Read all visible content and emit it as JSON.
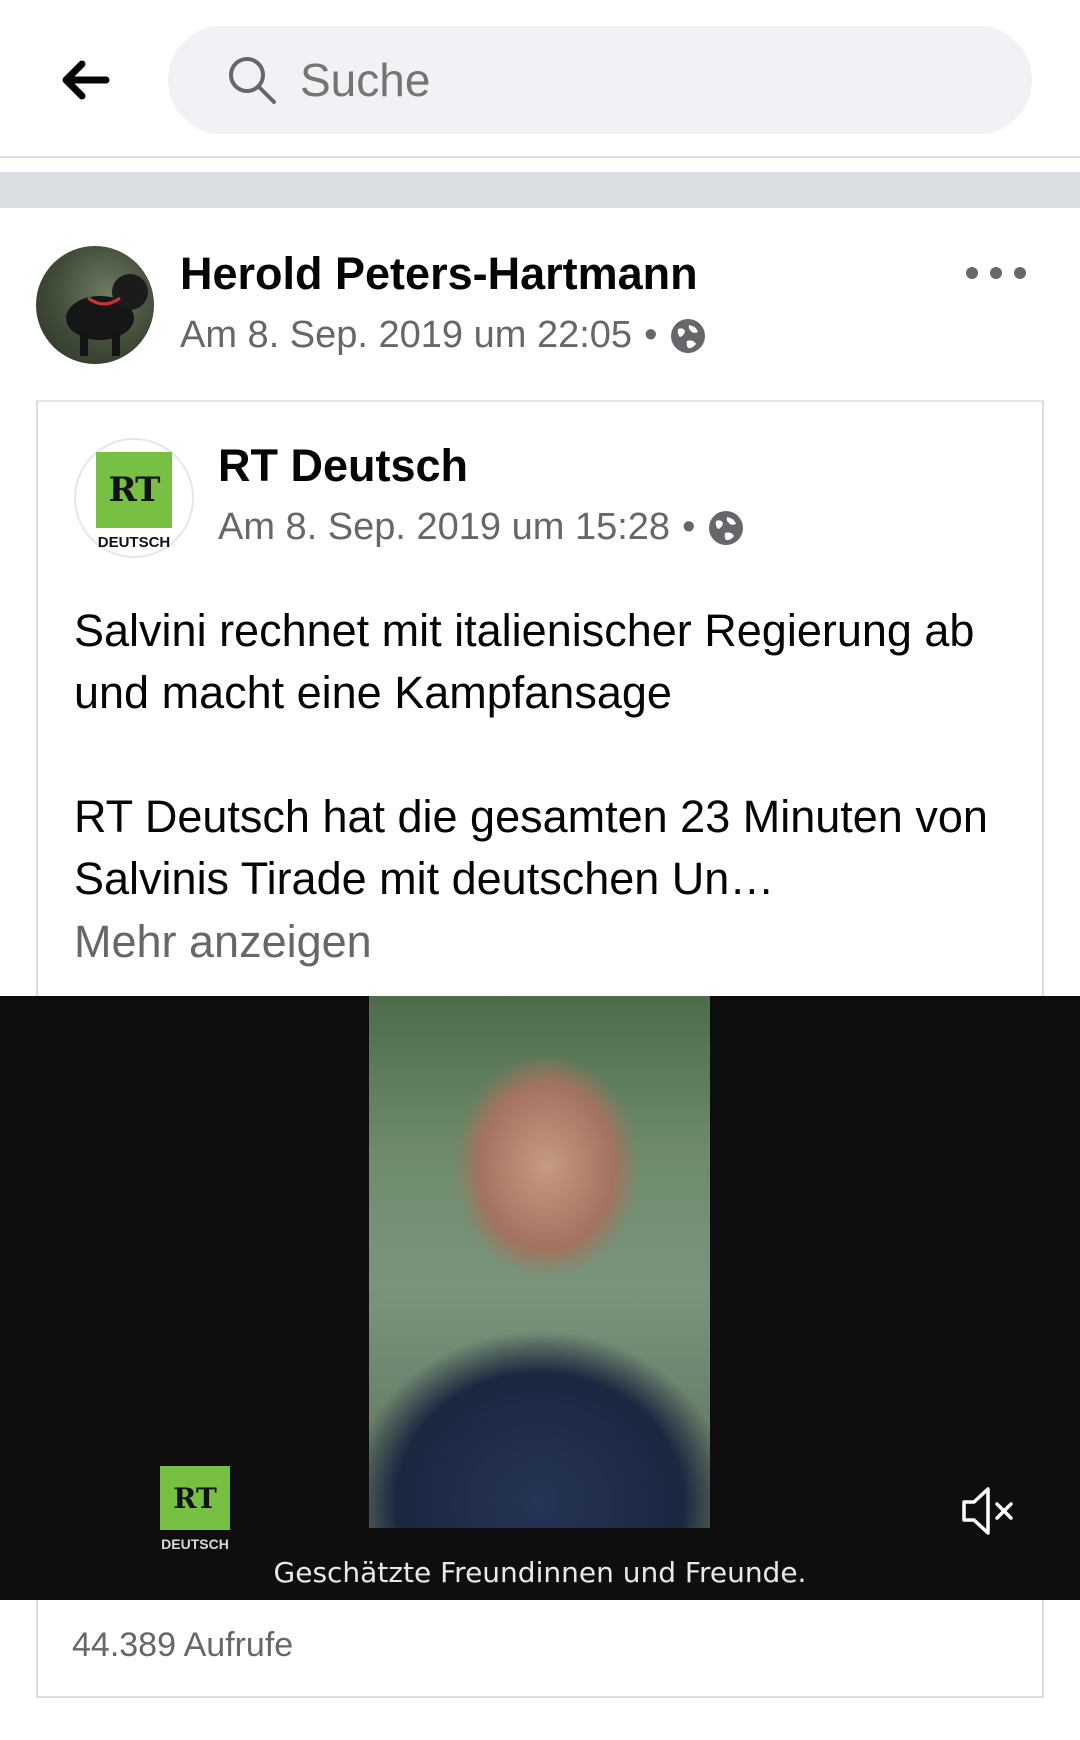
{
  "search": {
    "placeholder": "Suche"
  },
  "post": {
    "author": "Herold Peters-Hartmann",
    "timestamp": "Am 8. Sep. 2019 um 22:05",
    "separator": "•",
    "privacy_icon": "globe-icon",
    "more_icon": "more-options-icon"
  },
  "shared": {
    "page_logo_text": "RT",
    "page_logo_sub": "DEUTSCH",
    "page_name": "RT Deutsch",
    "timestamp": "Am 8. Sep. 2019 um 15:28",
    "separator": "•",
    "text_line1": "Salvini rechnet mit italienischer Regierung ab und macht eine Kampfansage",
    "text_line2": "RT Deutsch hat die gesamten 23 Minuten von Salvinis Tirade mit deutschen Un…",
    "see_more": "Mehr anzeigen"
  },
  "video": {
    "logo_text": "RT",
    "logo_sub": "DEUTSCH",
    "subtitle": "Geschätzte Freundinnen und Freunde.",
    "mute_icon": "volume-muted-icon",
    "views": "44.389 Aufrufe"
  },
  "colors": {
    "brand_green": "#77c043",
    "muted_text": "#65676b",
    "search_bg": "#f0f2f5"
  }
}
